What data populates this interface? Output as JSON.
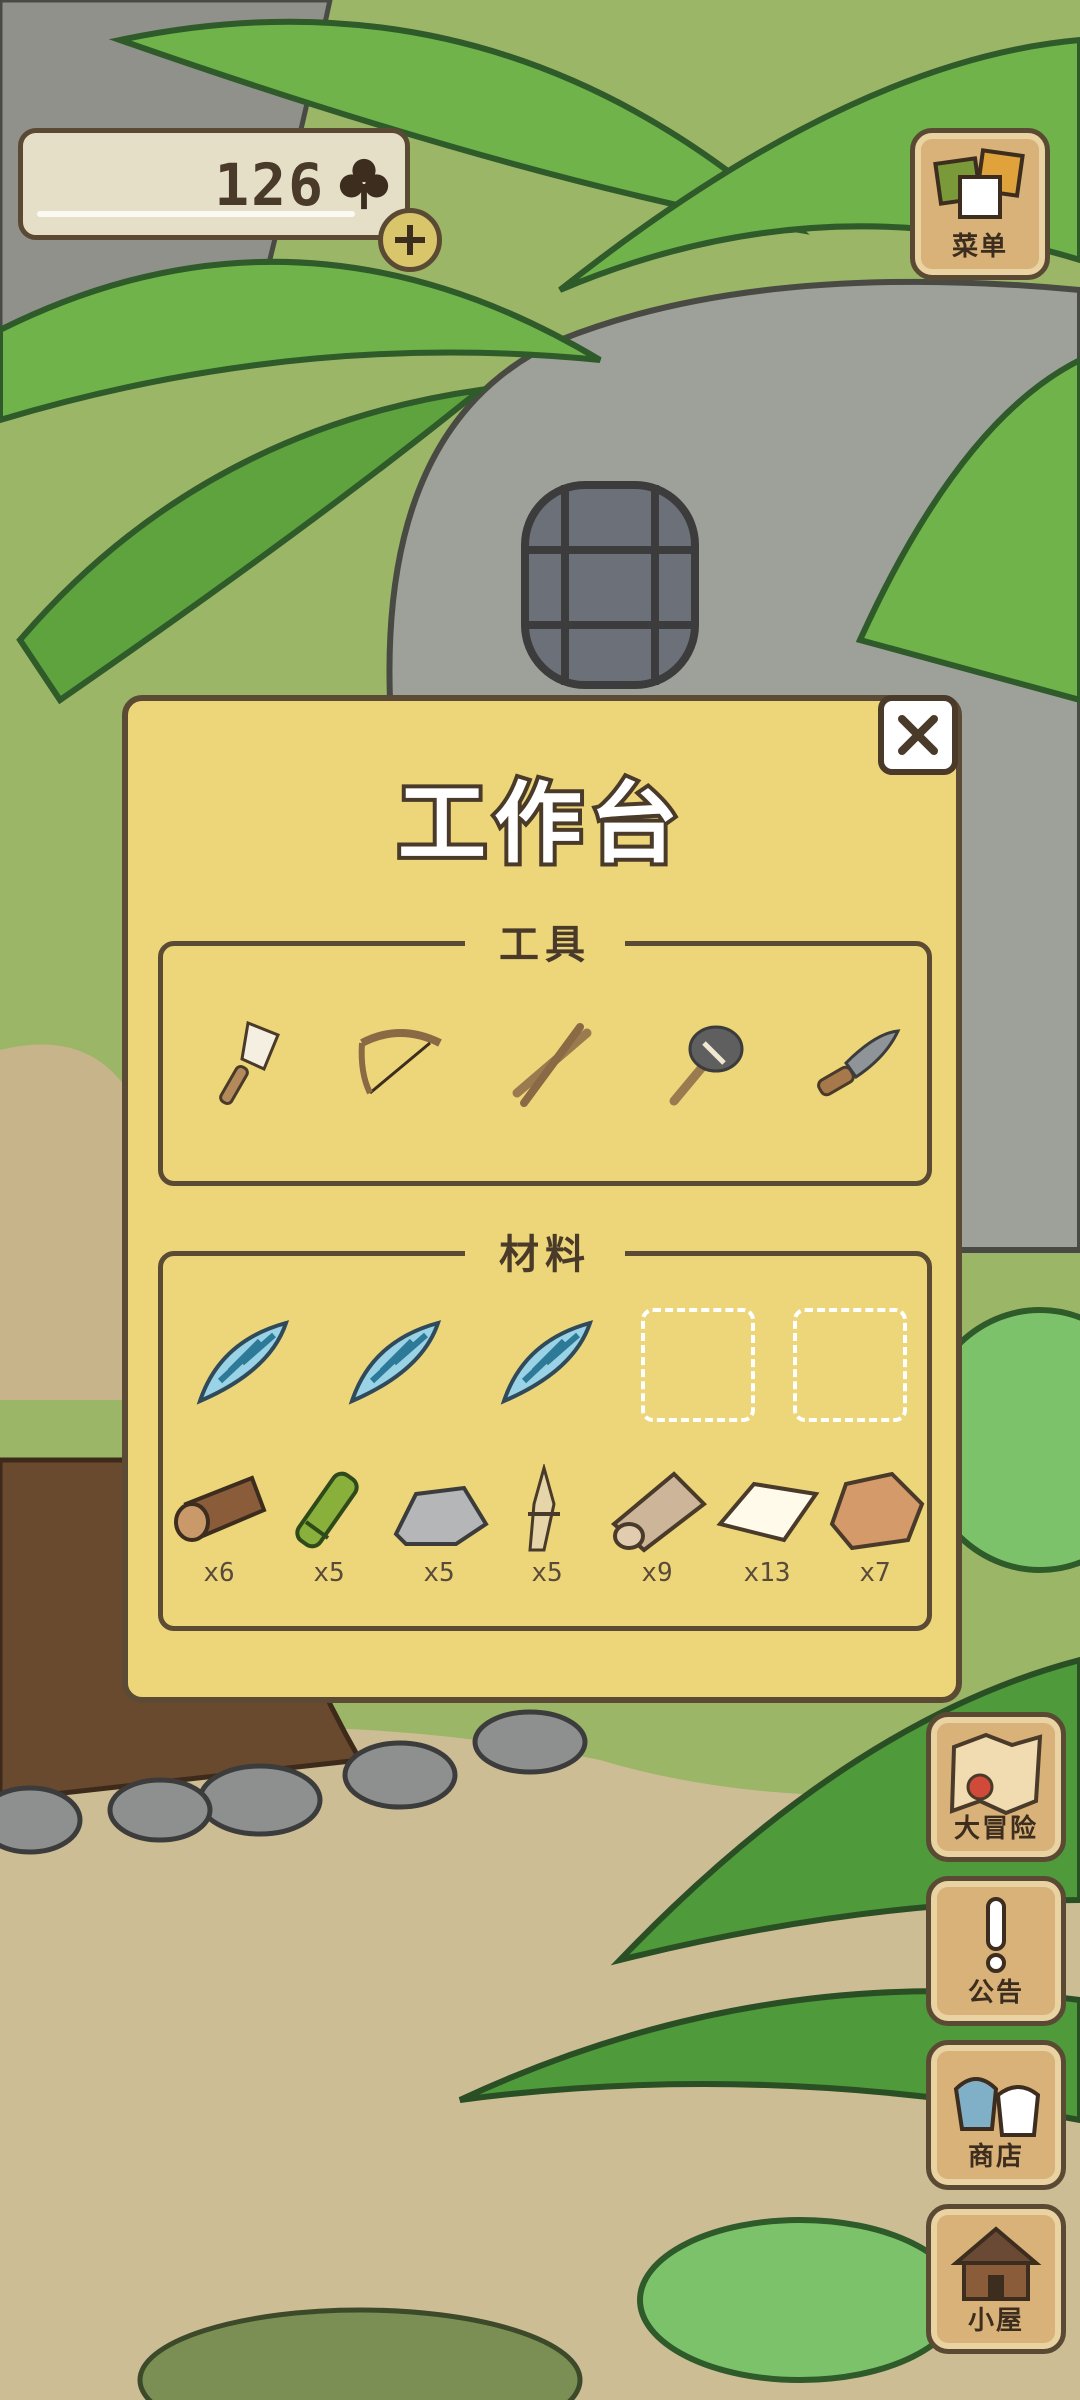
{
  "currency": {
    "amount": "126",
    "icon": "clover-icon"
  },
  "menu_button": {
    "label": "菜单",
    "icon": "menu-cards-icon"
  },
  "panel": {
    "title": "工作台",
    "tools_section": {
      "heading": "工具",
      "items": [
        {
          "icon": "brush-icon"
        },
        {
          "icon": "bow-icon"
        },
        {
          "icon": "sticks-icon"
        },
        {
          "icon": "stone-axe-icon"
        },
        {
          "icon": "knife-icon"
        }
      ]
    },
    "materials_section": {
      "heading": "材料",
      "shells": [
        {
          "icon": "shell-icon"
        },
        {
          "icon": "shell-icon"
        },
        {
          "icon": "shell-icon"
        }
      ],
      "empty_slots": 2,
      "items": [
        {
          "icon": "log-icon",
          "qty": "x6"
        },
        {
          "icon": "bamboo-icon",
          "qty": "x5"
        },
        {
          "icon": "stone-icon",
          "qty": "x5"
        },
        {
          "icon": "straw-icon",
          "qty": "x5"
        },
        {
          "icon": "cloth-roll-icon",
          "qty": "x9"
        },
        {
          "icon": "paper-icon",
          "qty": "x13"
        },
        {
          "icon": "clay-icon",
          "qty": "x7"
        }
      ]
    }
  },
  "side_nav": [
    {
      "label": "大冒险",
      "icon": "map-icon"
    },
    {
      "label": "公告",
      "icon": "exclamation-icon"
    },
    {
      "label": "商店",
      "icon": "bags-icon"
    },
    {
      "label": "小屋",
      "icon": "house-icon"
    }
  ],
  "colors": {
    "panel_bg": "#ecd679",
    "outline": "#5b4a34",
    "button_bg": "#d8b278"
  }
}
